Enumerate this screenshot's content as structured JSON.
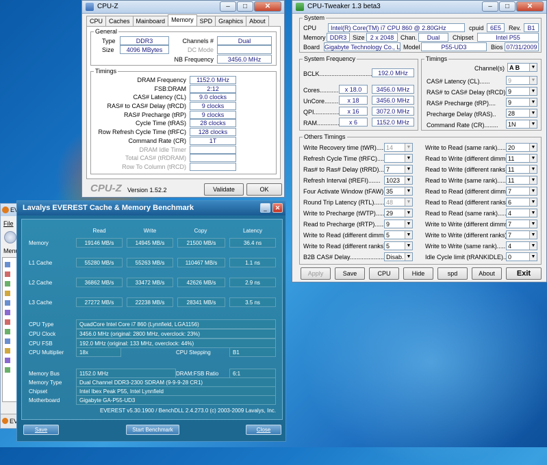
{
  "desktop": {
    "bg_color": "#1a78c8"
  },
  "cpuz": {
    "title": "CPU-Z",
    "tabs": [
      "CPU",
      "Caches",
      "Mainboard",
      "Memory",
      "SPD",
      "Graphics",
      "About"
    ],
    "active_tab": "Memory",
    "general": {
      "legend": "General",
      "type_label": "Type",
      "type_value": "DDR3",
      "size_label": "Size",
      "size_value": "4096 MBytes",
      "channels_label": "Channels #",
      "channels_value": "Dual",
      "dcmode_label": "DC Mode",
      "dcmode_value": "",
      "nbfreq_label": "NB Frequency",
      "nbfreq_value": "3456.0 MHz"
    },
    "timings": {
      "legend": "Timings",
      "rows": [
        {
          "label": "DRAM Frequency",
          "value": "1152.0 MHz"
        },
        {
          "label": "FSB:DRAM",
          "value": "2:12"
        },
        {
          "label": "CAS# Latency (CL)",
          "value": "9.0 clocks"
        },
        {
          "label": "RAS# to CAS# Delay (tRCD)",
          "value": "9 clocks"
        },
        {
          "label": "RAS# Precharge (tRP)",
          "value": "9 clocks"
        },
        {
          "label": "Cycle Time (tRAS)",
          "value": "28 clocks"
        },
        {
          "label": "Row Refresh Cycle Time (tRFC)",
          "value": "128 clocks"
        },
        {
          "label": "Command Rate (CR)",
          "value": "1T"
        },
        {
          "label": "DRAM Idle Timer",
          "value": ""
        },
        {
          "label": "Total CAS# (tRDRAM)",
          "value": ""
        },
        {
          "label": "Row To Column (tRCD)",
          "value": ""
        }
      ]
    },
    "brand": "CPU-Z",
    "version": "Version 1.52.2",
    "validate_label": "Validate",
    "ok_label": "OK"
  },
  "tweaker": {
    "title": "CPU-Tweaker 1.3 beta3",
    "system": {
      "legend": "System",
      "cpu_label": "CPU",
      "cpu_value": "Intel(R) Core(TM) i7 CPU       860  @ 2.80GHz",
      "cpuid_label": "cpuid",
      "cpuid_value": "6E5",
      "rev_label": "Rev.",
      "rev_value": "B1",
      "memory_label": "Memory",
      "memory_value": "DDR3",
      "size_label": "Size",
      "size_value": "2 x 2048",
      "chan_label": "Chan.",
      "chan_value": "Dual",
      "chipset_label": "Chipset",
      "chipset_value": "Intel P55",
      "board_label": "Board",
      "board_value": "Gigabyte Technology Co., Ltd.",
      "model_label": "Model",
      "model_value": "P55-UD3",
      "bios_label": "Bios",
      "bios_value": "07/31/2009"
    },
    "sysfreq": {
      "legend": "System Frequency",
      "bclk_label": "BCLK...............................",
      "bclk_value": "192.0 MHz",
      "rows": [
        {
          "label": "Cores...............",
          "mult": "x 18.0",
          "value": "3456.0 MHz"
        },
        {
          "label": "UnCore...........",
          "mult": "x 18",
          "value": "3456.0 MHz"
        },
        {
          "label": "QPI..................",
          "mult": "x 16",
          "value": "3072.0 MHz"
        },
        {
          "label": "RAM.................",
          "mult": "x 6",
          "value": "1152.0 MHz"
        }
      ]
    },
    "timings": {
      "legend": "Timings",
      "channels_label": "Channel(s)",
      "channels_value": "A  B",
      "rows": [
        {
          "label": "CAS# Latency (CL)......",
          "value": "9",
          "disabled": true
        },
        {
          "label": "RAS# to CAS# Delay (tRCD)",
          "value": "9",
          "disabled": false
        },
        {
          "label": "RAS# Precharge (tRP)....",
          "value": "9",
          "disabled": false
        },
        {
          "label": "Precharge Delay (tRAS)..",
          "value": "28",
          "disabled": false
        },
        {
          "label": "Command Rate (CR)........",
          "value": "1N",
          "disabled": false
        }
      ]
    },
    "others": {
      "legend": "Others Timings",
      "left": [
        {
          "label": "Write Recovery time (tWR)......",
          "value": "14",
          "disabled": true
        },
        {
          "label": "Refresh Cycle Time (tRFC).....",
          "value": "",
          "disabled": false
        },
        {
          "label": "Ras# to Ras# Delay (tRRD).....",
          "value": "7",
          "disabled": false
        },
        {
          "label": "Refresh Interval (tREFI).......",
          "value": "1023",
          "disabled": false
        },
        {
          "label": "Four Activate Window (tFAW)....",
          "value": "35",
          "disabled": false
        },
        {
          "label": "Round Trip Latency (RTL)........",
          "value": "48",
          "disabled": true
        },
        {
          "label": "Write to Precharge (tWTP).......",
          "value": "29",
          "disabled": false
        },
        {
          "label": "Read to Precharge (tRTP).......",
          "value": "9",
          "disabled": false
        },
        {
          "label": "Write to Read (different dimms)..",
          "value": "5",
          "disabled": false
        },
        {
          "label": "Write to Read (different ranks)..",
          "value": "5",
          "disabled": false
        },
        {
          "label": "B2B CAS# Delay.....................",
          "value": "Disab.",
          "disabled": false
        }
      ],
      "right": [
        {
          "label": "Write to Read (same rank)......",
          "value": "20"
        },
        {
          "label": "Read to Write (different dimms)..",
          "value": "11"
        },
        {
          "label": "Read to Write (different ranks)..",
          "value": "11"
        },
        {
          "label": "Read to Write (same rank).......",
          "value": "11"
        },
        {
          "label": "Read to Read (different dimms)...",
          "value": "7"
        },
        {
          "label": "Read to Read (different ranks)...",
          "value": "6"
        },
        {
          "label": "Read to Read (same rank)........",
          "value": "4"
        },
        {
          "label": "Write to Write (different dimms)..",
          "value": "7"
        },
        {
          "label": "Write to Write (different ranks)..",
          "value": "7"
        },
        {
          "label": "Write to Write (same rank)........",
          "value": "4"
        },
        {
          "label": "Idle Cycle limit (tRANKIDLE)......",
          "value": "0"
        }
      ]
    },
    "buttons": {
      "apply": "Apply",
      "save": "Save",
      "cpu": "CPU",
      "hide": "Hide",
      "spd": "spd",
      "about": "About",
      "exit": "Exit"
    }
  },
  "everest": {
    "title": "Lavalys EVEREST Cache & Memory Benchmark",
    "headers": [
      "Read",
      "Write",
      "Copy",
      "Latency"
    ],
    "bench_rows": [
      {
        "label": "Memory",
        "read": "19146 MB/s",
        "write": "14945 MB/s",
        "copy": "21500 MB/s",
        "latency": "36.4 ns"
      },
      {
        "label": "L1 Cache",
        "read": "55280 MB/s",
        "write": "55263 MB/s",
        "copy": "110467 MB/s",
        "latency": "1.1 ns"
      },
      {
        "label": "L2 Cache",
        "read": "36862 MB/s",
        "write": "33472 MB/s",
        "copy": "42626 MB/s",
        "latency": "2.9 ns"
      },
      {
        "label": "L3 Cache",
        "read": "27272 MB/s",
        "write": "22238 MB/s",
        "copy": "28341 MB/s",
        "latency": "3.5 ns"
      }
    ],
    "cpu_type_label": "CPU Type",
    "cpu_type_value": "QuadCore Intel Core i7 860  (Lynnfield, LGA1156)",
    "cpu_clock_label": "CPU Clock",
    "cpu_clock_value": "3456.0 MHz  (original: 2800 MHz, overclock: 23%)",
    "cpu_fsb_label": "CPU FSB",
    "cpu_fsb_value": "192.0 MHz  (original: 133 MHz, overclock: 44%)",
    "cpu_mult_label": "CPU Multiplier",
    "cpu_mult_value": "18x",
    "cpu_stepping_label": "CPU Stepping",
    "cpu_stepping_value": "B1",
    "mem_bus_label": "Memory Bus",
    "mem_bus_value": "1152.0 MHz",
    "dram_fsb_label": "DRAM:FSB Ratio",
    "dram_fsb_value": "6:1",
    "mem_type_label": "Memory Type",
    "mem_type_value": "Dual Channel DDR3-2300 SDRAM  (9-9-9-28 CR1)",
    "chipset_label": "Chipset",
    "chipset_value": "Intel Ibex Peak P55, Intel Lynnfield",
    "mobo_label": "Motherboard",
    "mobo_value": "Gigabyte GA-P55-UD3",
    "footer": "EVEREST v5.30.1900 / BenchDLL 2.4.273.0  (c) 2003-2009 Lavalys, Inc.",
    "save_label": "Save",
    "start_label": "Start Benchmark",
    "close_label": "Close"
  },
  "behind_window": {
    "title_fragment": "EV",
    "menu_file": "File",
    "menu_label": "Menu"
  }
}
